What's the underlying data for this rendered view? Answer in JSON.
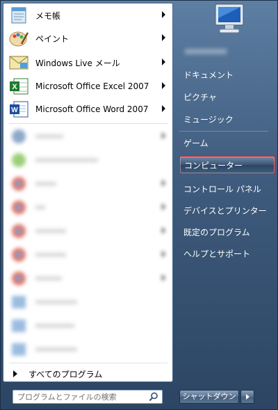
{
  "pinned": [
    {
      "label": "メモ帳",
      "icon": "notepad-icon"
    },
    {
      "label": "ペイント",
      "icon": "paint-icon"
    },
    {
      "label": "Windows Live メール",
      "icon": "windows-live-mail-icon"
    },
    {
      "label": "Microsoft Office Excel 2007",
      "icon": "excel-icon"
    },
    {
      "label": "Microsoft Office Word 2007",
      "icon": "word-icon"
    }
  ],
  "all_programs": "すべてのプログラム",
  "search": {
    "placeholder": "プログラムとファイルの検索"
  },
  "right_items": [
    "ドキュメント",
    "ピクチャ",
    "ミュージック",
    "ゲーム",
    "コンピューター",
    "コントロール パネル",
    "デバイスとプリンター",
    "既定のプログラム",
    "ヘルプとサポート"
  ],
  "shutdown": {
    "label": "シャットダウン"
  },
  "colors": {
    "highlight_border": "#d21e2a",
    "panel": "#3e5a7c"
  }
}
